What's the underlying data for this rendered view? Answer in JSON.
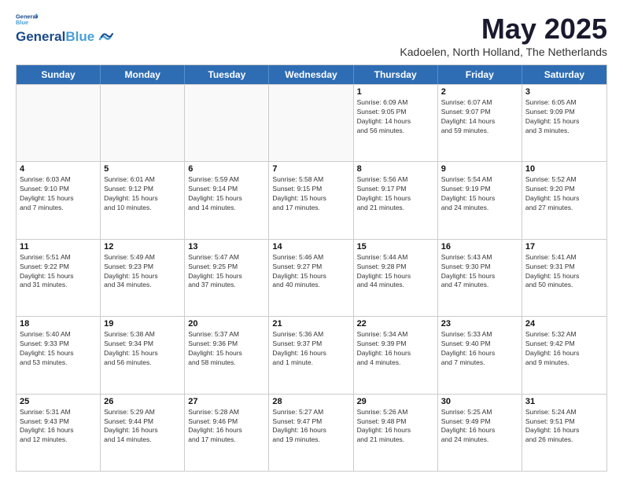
{
  "logo": {
    "general": "General",
    "blue": "Blue"
  },
  "title": "May 2025",
  "location": "Kadoelen, North Holland, The Netherlands",
  "header_days": [
    "Sunday",
    "Monday",
    "Tuesday",
    "Wednesday",
    "Thursday",
    "Friday",
    "Saturday"
  ],
  "weeks": [
    [
      {
        "day": "",
        "info": "",
        "empty": true
      },
      {
        "day": "",
        "info": "",
        "empty": true
      },
      {
        "day": "",
        "info": "",
        "empty": true
      },
      {
        "day": "",
        "info": "",
        "empty": true
      },
      {
        "day": "1",
        "info": "Sunrise: 6:09 AM\nSunset: 9:05 PM\nDaylight: 14 hours\nand 56 minutes."
      },
      {
        "day": "2",
        "info": "Sunrise: 6:07 AM\nSunset: 9:07 PM\nDaylight: 14 hours\nand 59 minutes."
      },
      {
        "day": "3",
        "info": "Sunrise: 6:05 AM\nSunset: 9:09 PM\nDaylight: 15 hours\nand 3 minutes."
      }
    ],
    [
      {
        "day": "4",
        "info": "Sunrise: 6:03 AM\nSunset: 9:10 PM\nDaylight: 15 hours\nand 7 minutes."
      },
      {
        "day": "5",
        "info": "Sunrise: 6:01 AM\nSunset: 9:12 PM\nDaylight: 15 hours\nand 10 minutes."
      },
      {
        "day": "6",
        "info": "Sunrise: 5:59 AM\nSunset: 9:14 PM\nDaylight: 15 hours\nand 14 minutes."
      },
      {
        "day": "7",
        "info": "Sunrise: 5:58 AM\nSunset: 9:15 PM\nDaylight: 15 hours\nand 17 minutes."
      },
      {
        "day": "8",
        "info": "Sunrise: 5:56 AM\nSunset: 9:17 PM\nDaylight: 15 hours\nand 21 minutes."
      },
      {
        "day": "9",
        "info": "Sunrise: 5:54 AM\nSunset: 9:19 PM\nDaylight: 15 hours\nand 24 minutes."
      },
      {
        "day": "10",
        "info": "Sunrise: 5:52 AM\nSunset: 9:20 PM\nDaylight: 15 hours\nand 27 minutes."
      }
    ],
    [
      {
        "day": "11",
        "info": "Sunrise: 5:51 AM\nSunset: 9:22 PM\nDaylight: 15 hours\nand 31 minutes."
      },
      {
        "day": "12",
        "info": "Sunrise: 5:49 AM\nSunset: 9:23 PM\nDaylight: 15 hours\nand 34 minutes."
      },
      {
        "day": "13",
        "info": "Sunrise: 5:47 AM\nSunset: 9:25 PM\nDaylight: 15 hours\nand 37 minutes."
      },
      {
        "day": "14",
        "info": "Sunrise: 5:46 AM\nSunset: 9:27 PM\nDaylight: 15 hours\nand 40 minutes."
      },
      {
        "day": "15",
        "info": "Sunrise: 5:44 AM\nSunset: 9:28 PM\nDaylight: 15 hours\nand 44 minutes."
      },
      {
        "day": "16",
        "info": "Sunrise: 5:43 AM\nSunset: 9:30 PM\nDaylight: 15 hours\nand 47 minutes."
      },
      {
        "day": "17",
        "info": "Sunrise: 5:41 AM\nSunset: 9:31 PM\nDaylight: 15 hours\nand 50 minutes."
      }
    ],
    [
      {
        "day": "18",
        "info": "Sunrise: 5:40 AM\nSunset: 9:33 PM\nDaylight: 15 hours\nand 53 minutes."
      },
      {
        "day": "19",
        "info": "Sunrise: 5:38 AM\nSunset: 9:34 PM\nDaylight: 15 hours\nand 56 minutes."
      },
      {
        "day": "20",
        "info": "Sunrise: 5:37 AM\nSunset: 9:36 PM\nDaylight: 15 hours\nand 58 minutes."
      },
      {
        "day": "21",
        "info": "Sunrise: 5:36 AM\nSunset: 9:37 PM\nDaylight: 16 hours\nand 1 minute."
      },
      {
        "day": "22",
        "info": "Sunrise: 5:34 AM\nSunset: 9:39 PM\nDaylight: 16 hours\nand 4 minutes."
      },
      {
        "day": "23",
        "info": "Sunrise: 5:33 AM\nSunset: 9:40 PM\nDaylight: 16 hours\nand 7 minutes."
      },
      {
        "day": "24",
        "info": "Sunrise: 5:32 AM\nSunset: 9:42 PM\nDaylight: 16 hours\nand 9 minutes."
      }
    ],
    [
      {
        "day": "25",
        "info": "Sunrise: 5:31 AM\nSunset: 9:43 PM\nDaylight: 16 hours\nand 12 minutes."
      },
      {
        "day": "26",
        "info": "Sunrise: 5:29 AM\nSunset: 9:44 PM\nDaylight: 16 hours\nand 14 minutes."
      },
      {
        "day": "27",
        "info": "Sunrise: 5:28 AM\nSunset: 9:46 PM\nDaylight: 16 hours\nand 17 minutes."
      },
      {
        "day": "28",
        "info": "Sunrise: 5:27 AM\nSunset: 9:47 PM\nDaylight: 16 hours\nand 19 minutes."
      },
      {
        "day": "29",
        "info": "Sunrise: 5:26 AM\nSunset: 9:48 PM\nDaylight: 16 hours\nand 21 minutes."
      },
      {
        "day": "30",
        "info": "Sunrise: 5:25 AM\nSunset: 9:49 PM\nDaylight: 16 hours\nand 24 minutes."
      },
      {
        "day": "31",
        "info": "Sunrise: 5:24 AM\nSunset: 9:51 PM\nDaylight: 16 hours\nand 26 minutes."
      }
    ]
  ]
}
